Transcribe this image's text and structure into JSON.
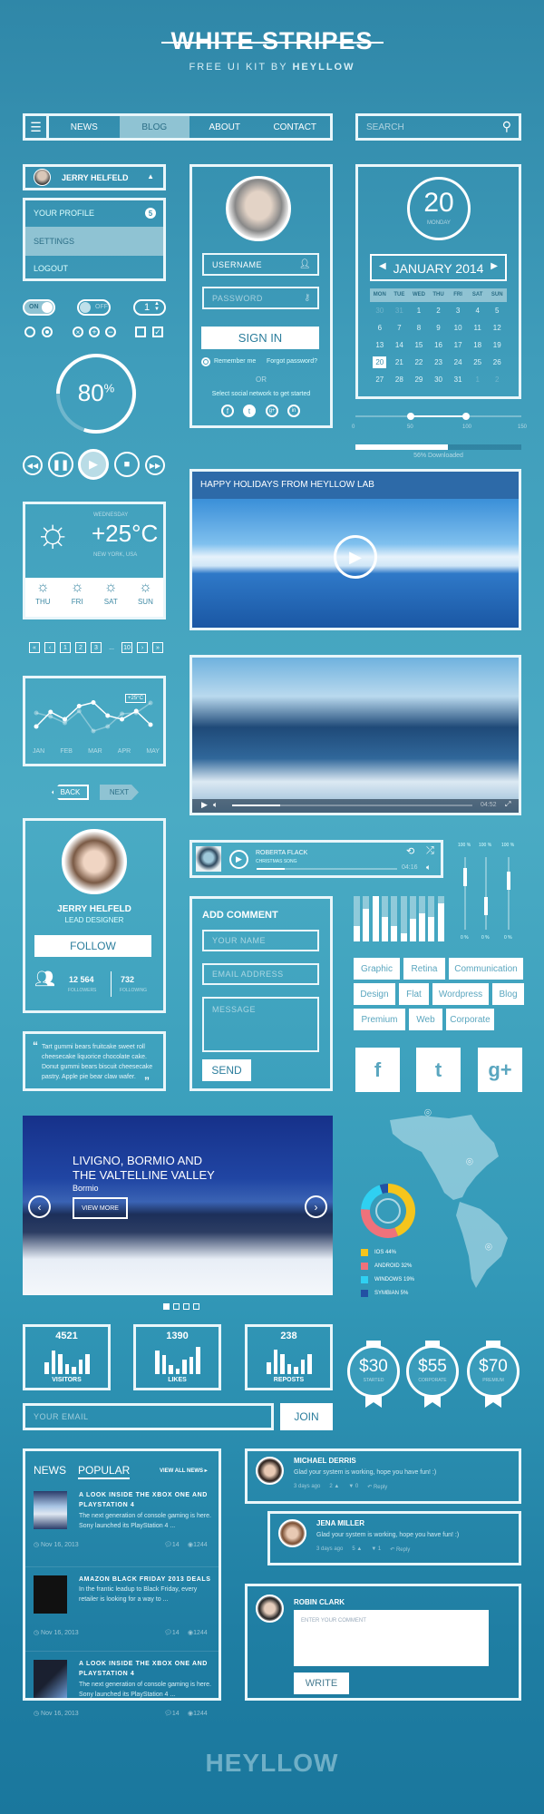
{
  "header": {
    "title": "WHITE STRIPES",
    "subtitle_prefix": "FREE UI KIT BY",
    "subtitle_brand": "HEYLLOW"
  },
  "nav": {
    "items": [
      "NEWS",
      "BLOG",
      "ABOUT",
      "CONTACT"
    ],
    "active": "BLOG"
  },
  "search": {
    "placeholder": "SEARCH"
  },
  "user_menu": {
    "name": "JERRY HELFELD",
    "items": [
      {
        "label": "YOUR PROFILE",
        "badge": "5"
      },
      {
        "label": "SETTINGS"
      },
      {
        "label": "LOGOUT"
      }
    ],
    "active": "SETTINGS"
  },
  "controls": {
    "toggle_on": "ON",
    "toggle_off": "OFF",
    "stepper_value": "1",
    "progress_percent": 80,
    "progress_label": "80",
    "progress_unit": "%"
  },
  "login": {
    "username_value": "USERNAME",
    "password_placeholder": "PASSWORD",
    "sign_in": "SIGN IN",
    "remember": "Remember me",
    "forgot": "Forgot password?",
    "or": "OR",
    "social_prompt": "Select social network to get started"
  },
  "calendar": {
    "day": "20",
    "weekday": "MONDAY",
    "month": "JANUARY 2014",
    "headers": [
      "MON",
      "TUE",
      "WED",
      "THU",
      "FRI",
      "SAT",
      "SUN"
    ],
    "weeks": [
      [
        "30",
        "31",
        "1",
        "2",
        "3",
        "4",
        "5"
      ],
      [
        "6",
        "7",
        "8",
        "9",
        "10",
        "11",
        "12"
      ],
      [
        "13",
        "14",
        "15",
        "16",
        "17",
        "18",
        "19"
      ],
      [
        "20",
        "21",
        "22",
        "23",
        "24",
        "25",
        "26"
      ],
      [
        "27",
        "28",
        "29",
        "30",
        "31",
        "1",
        "2"
      ]
    ],
    "selected": "20"
  },
  "range_slider": {
    "ticks": [
      "0",
      "50",
      "100",
      "150"
    ],
    "low": 50,
    "high": 100
  },
  "download": {
    "percent": 56,
    "label": "56% Downloaded"
  },
  "weather": {
    "day": "WEDNESDAY",
    "temp": "+25°C",
    "location": "NEW YORK, USA",
    "forecast": [
      "THU",
      "FRI",
      "SAT",
      "SUN"
    ]
  },
  "video1": {
    "title": "HAPPY HOLIDAYS FROM HEYLLOW LAB"
  },
  "video2": {
    "time": "04:52",
    "progress": 0.2
  },
  "pagination": {
    "items": [
      "«",
      "‹",
      "1",
      "2",
      "3",
      "...",
      "10",
      "›",
      "»"
    ]
  },
  "line_chart": {
    "months": [
      "JAN",
      "FEB",
      "MAR",
      "APR",
      "MAY"
    ],
    "tooltip": "+25°C",
    "series_a": [
      30,
      62,
      46,
      75,
      83,
      54,
      46,
      64,
      34
    ],
    "series_b": [
      60,
      52,
      38,
      64,
      20,
      30,
      58,
      60,
      82
    ]
  },
  "wizard": {
    "back": "BACK",
    "next": "NEXT"
  },
  "profile": {
    "name": "JERRY HELFELD",
    "role": "LEAD DESIGNER",
    "follow": "FOLLOW",
    "followers": "12 564",
    "followers_label": "FOLLOWERS",
    "following": "732",
    "following_label": "FOLLOWING"
  },
  "quote": {
    "text": "Tart gummi bears fruitcake sweet roll cheesecake liquorice chocolate cake. Donut gummi bears biscuit cheesecake pastry. Apple pie bear claw wafer."
  },
  "music": {
    "artist": "ROBERTA FLACK",
    "song": "CHRISTMAS SONG",
    "time": "04:16",
    "progress": 0.2
  },
  "volume": {
    "top": "100 %",
    "bottom": "0 %",
    "levels": [
      0.85,
      0.45,
      0.8
    ]
  },
  "equalizer": [
    0.35,
    0.72,
    1,
    0.55,
    0.35,
    0.18,
    0.5,
    0.62,
    0.55,
    0.85
  ],
  "comment_form": {
    "title": "ADD COMMENT",
    "name_placeholder": "YOUR NAME",
    "email_placeholder": "EMAIL ADDRESS",
    "message_placeholder": "MESSAGE",
    "send": "SEND"
  },
  "tags": [
    [
      "Graphic",
      "Retina",
      "Communication"
    ],
    [
      "Design",
      "Flat",
      "Wordpress",
      "Blog"
    ],
    [
      "Premium",
      "Web",
      "Corporate"
    ]
  ],
  "social_tiles": [
    "f",
    "t",
    "g+"
  ],
  "slider": {
    "title_line1": "LIVIGNO,  BORMIO AND",
    "title_line2": "THE VALTELLINE VALLEY",
    "subtitle": "Bormio",
    "button": "VIEW MORE",
    "pages": 4,
    "active_page": 1
  },
  "donut": {
    "series": [
      {
        "name": "IOS",
        "value": 44,
        "label": "IOS  44%",
        "color": "#f5c51c"
      },
      {
        "name": "ANDROID",
        "value": 32,
        "label": "ANDROID  32%",
        "color": "#ef727b"
      },
      {
        "name": "WINDOWS",
        "value": 19,
        "label": "WINDOWS  19%",
        "color": "#2fd0f2"
      },
      {
        "name": "SYMBIAN",
        "value": 5,
        "label": "SYMBIAN  5%",
        "color": "#2351a3"
      }
    ]
  },
  "stats": [
    {
      "value": "4521",
      "label": "VISITORS",
      "bars": [
        0.4,
        0.8,
        0.7,
        0.35,
        0.25,
        0.5,
        0.7
      ]
    },
    {
      "value": "1390",
      "label": "LIKES",
      "bars": [
        0.8,
        0.65,
        0.3,
        0.2,
        0.5,
        0.6,
        0.95
      ]
    },
    {
      "value": "238",
      "label": "REPOSTS",
      "bars": [
        0.4,
        0.85,
        0.7,
        0.35,
        0.25,
        0.5,
        0.7
      ]
    }
  ],
  "pricing": [
    {
      "price": "$30",
      "plan": "STARTED"
    },
    {
      "price": "$55",
      "plan": "CORPORATE"
    },
    {
      "price": "$70",
      "plan": "PREMIUM"
    }
  ],
  "newsletter": {
    "placeholder": "YOUR EMAIL",
    "button": "JOIN"
  },
  "news": {
    "tabs": [
      "NEWS",
      "POPULAR"
    ],
    "active_tab": "POPULAR",
    "view_all": "VIEW ALL NEWS",
    "items": [
      {
        "title": "A LOOK INSIDE THE XBOX ONE AND PLAYSTATION 4",
        "excerpt": "The next generation of console gaming is here. Sony launched its PlayStation 4 ...",
        "date": "Nov 16, 2013",
        "comments": "14",
        "views": "1244"
      },
      {
        "title": "AMAZON BLACK FRIDAY 2013 DEALS",
        "excerpt": "In the frantic leadup to Black Friday, every retailer is looking for a way to ...",
        "date": "Nov 16, 2013",
        "comments": "14",
        "views": "1244"
      },
      {
        "title": "A LOOK INSIDE THE XBOX ONE AND PLAYSTATION 4",
        "excerpt": "The next generation of console gaming is here. Sony launched its PlayStation 4 ...",
        "date": "Nov 16, 2013",
        "comments": "14",
        "views": "1244"
      }
    ]
  },
  "comments": [
    {
      "author": "MICHAEL DERRIS",
      "text": "Glad your system is working, hope you have fun! :)",
      "time": "3 days ago",
      "up": "2",
      "down": "0",
      "reply": "Reply"
    },
    {
      "author": "JENA MILLER",
      "text": "Glad your system is working, hope you have fun! :)",
      "time": "3 days ago",
      "up": "5",
      "down": "1",
      "reply": "Reply"
    }
  ],
  "comment_box": {
    "author": "ROBIN CLARK",
    "placeholder": "ENTER YOUR COMMENT",
    "button": "WRITE"
  },
  "footer": {
    "brand": "HEYLLOW"
  },
  "colors": {
    "background": "#3f9dbb",
    "card_border": "#e9f6fa",
    "highlight": "#8fc3d3"
  }
}
